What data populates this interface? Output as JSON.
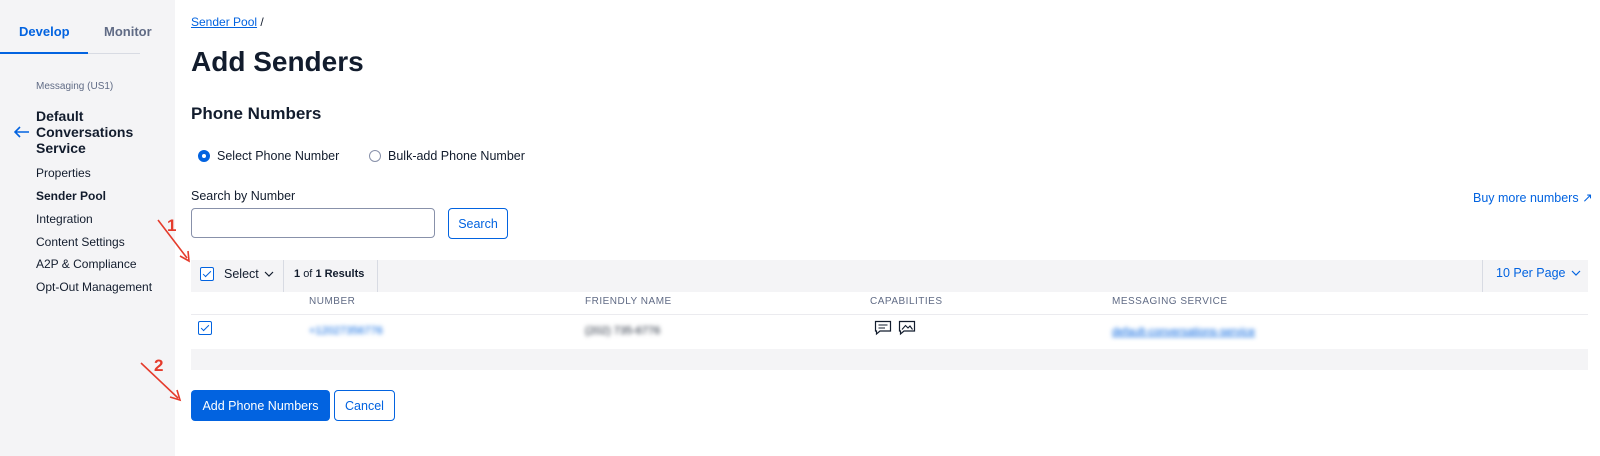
{
  "sidebar": {
    "tabs": [
      "Develop",
      "Monitor"
    ],
    "region": "Messaging (US1)",
    "service_title": "Default Conversations Service",
    "items": [
      "Properties",
      "Sender Pool",
      "Integration",
      "Content Settings",
      "A2P & Compliance",
      "Opt-Out Management"
    ]
  },
  "breadcrumb": {
    "link": "Sender Pool",
    "separator": " /"
  },
  "page": {
    "title": "Add Senders",
    "section_title": "Phone Numbers"
  },
  "radios": {
    "select": "Select Phone Number",
    "bulk": "Bulk-add Phone Number"
  },
  "search": {
    "label": "Search by Number",
    "value": "",
    "button": "Search"
  },
  "buy_more": "Buy more numbers ↗",
  "table": {
    "select_label": "Select",
    "results_count": "1",
    "results_of": "of",
    "results_total": "1 Results",
    "per_page": "10 Per Page",
    "columns": [
      "NUMBER",
      "FRIENDLY NAME",
      "CAPABILITIES",
      "MESSAGING SERVICE"
    ],
    "rows": [
      {
        "number": "+12027356776",
        "friendly_name": "(202) 735-6776",
        "messaging_service": "default-conversations-service"
      }
    ]
  },
  "actions": {
    "add": "Add Phone Numbers",
    "cancel": "Cancel"
  },
  "annotations": [
    "1",
    "2"
  ],
  "colors": {
    "accent": "#0263e0",
    "annotation": "#e53b2c",
    "sidebar_bg": "#f4f4f6"
  },
  "icons": [
    "back-arrow-icon",
    "chevron-down-icon",
    "sms-icon",
    "mms-icon",
    "external-link-icon"
  ]
}
